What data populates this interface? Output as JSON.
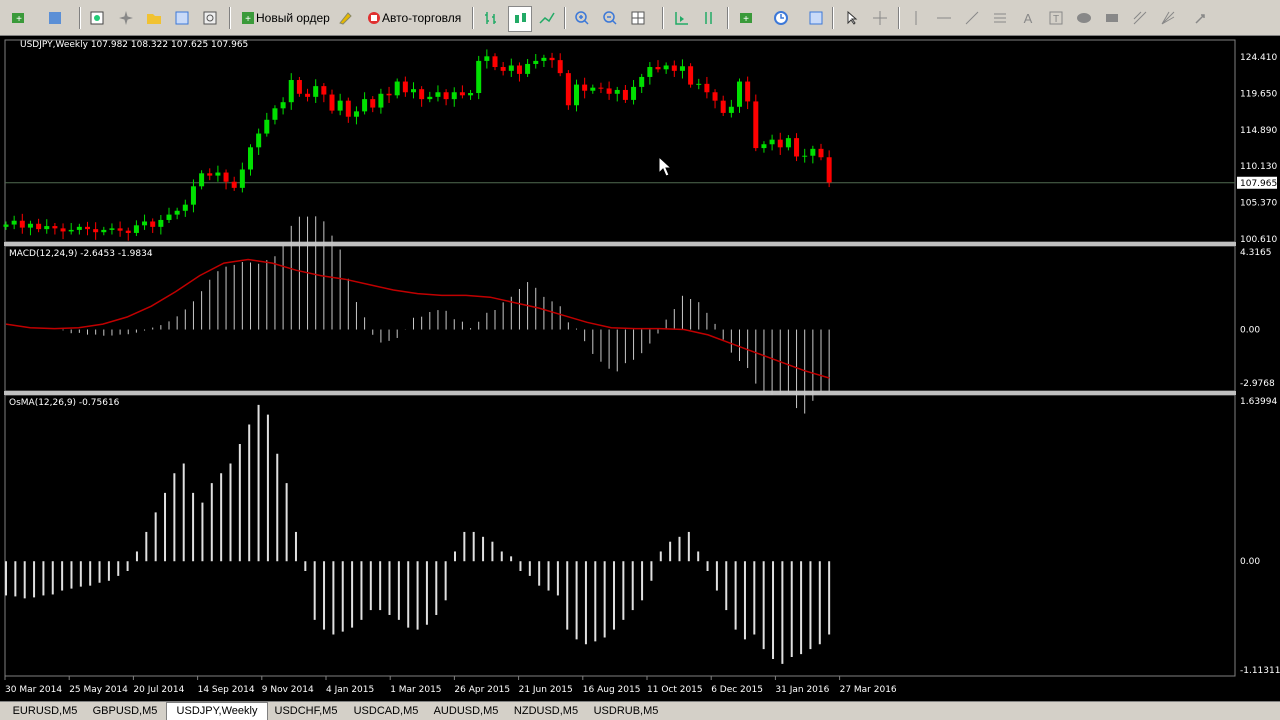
{
  "toolbar": {
    "new_order_label": "Новый ордер",
    "auto_trading_label": "Авто-торговля"
  },
  "chart": {
    "header": "USDJPY,Weekly  107.982 108.322 107.625 107.965",
    "price_axis": [
      "124.410",
      "119.650",
      "114.890",
      "110.130",
      "105.370",
      "100.610"
    ],
    "current_price": "107.965",
    "time_axis": [
      "30 Mar 2014",
      "25 May 2014",
      "20 Jul 2014",
      "14 Sep 2014",
      "9 Nov 2014",
      "4 Jan 2015",
      "1 Mar 2015",
      "26 Apr 2015",
      "21 Jun 2015",
      "16 Aug 2015",
      "11 Oct 2015",
      "6 Dec 2015",
      "31 Jan 2016",
      "27 Mar 2016"
    ]
  },
  "macd": {
    "label": "MACD(12,24,9) -2.6453 -1.9834",
    "scale": [
      "4.3165",
      "0.00",
      "-2.9768"
    ]
  },
  "osma": {
    "label": "OsMA(12,26,9) -0.75616",
    "scale": [
      "1.63994",
      "0.00",
      "-1.11311"
    ]
  },
  "colors": {
    "bull": "#00e000",
    "bear": "#ff0000",
    "grid": "#808080",
    "signal": "#c00000"
  },
  "tabs": [
    "EURUSD,M5",
    "GBPUSD,M5",
    "USDJPY,Weekly",
    "USDCHF,M5",
    "USDCAD,M5",
    "AUDUSD,M5",
    "NZDUSD,M5",
    "USDRUB,M5"
  ],
  "active_tab": "USDJPY,Weekly",
  "chart_data": {
    "type": "candlestick",
    "symbol": "USDJPY",
    "timeframe": "Weekly",
    "ohlc_last": {
      "open": 107.982,
      "high": 108.322,
      "low": 107.625,
      "close": 107.965
    },
    "closes": [
      102.5,
      103.0,
      102.1,
      102.6,
      101.9,
      102.3,
      102.0,
      101.6,
      101.8,
      102.2,
      101.9,
      101.5,
      101.8,
      102.0,
      101.7,
      101.4,
      102.4,
      102.9,
      102.2,
      103.1,
      103.8,
      104.3,
      105.1,
      107.5,
      109.2,
      108.9,
      109.3,
      108.1,
      107.3,
      109.7,
      112.6,
      114.4,
      116.2,
      117.7,
      118.5,
      121.4,
      119.6,
      119.2,
      120.6,
      119.5,
      117.4,
      118.7,
      116.6,
      117.3,
      118.9,
      117.8,
      119.6,
      119.4,
      121.2,
      119.8,
      120.2,
      118.9,
      119.2,
      119.8,
      118.9,
      119.8,
      119.4,
      119.7,
      123.9,
      124.5,
      123.1,
      122.6,
      123.3,
      122.2,
      123.5,
      123.9,
      124.3,
      124.0,
      122.3,
      118.1,
      120.8,
      120.0,
      120.4,
      120.3,
      119.6,
      120.1,
      118.8,
      120.5,
      121.8,
      123.1,
      122.8,
      123.3,
      122.6,
      123.2,
      120.8,
      120.9,
      119.8,
      118.7,
      117.1,
      117.9,
      121.2,
      118.6,
      112.5,
      113.0,
      113.6,
      112.6,
      113.8,
      111.4,
      111.5,
      112.4,
      111.3,
      108.0
    ],
    "macd_first": 0.8,
    "macd_zero_index": 26,
    "macd_signal_points": [
      0.3,
      0.1,
      0.05,
      0.1,
      0.3,
      0.7,
      1.3,
      2.1,
      3.0,
      3.7,
      3.9,
      3.7,
      3.3,
      3.0,
      2.8,
      2.5,
      2.2,
      2.0,
      1.9,
      1.9,
      1.8,
      1.5,
      1.2,
      0.8,
      0.4,
      0.1,
      0.05,
      0.05,
      0.0,
      -0.3,
      -0.8,
      -1.3,
      -1.8,
      -2.3,
      -2.7
    ],
    "osma_values": [
      -0.35,
      -0.36,
      -0.38,
      -0.37,
      -0.35,
      -0.34,
      -0.3,
      -0.28,
      -0.26,
      -0.25,
      -0.22,
      -0.2,
      -0.15,
      -0.1,
      0.1,
      0.3,
      0.5,
      0.7,
      0.9,
      1.0,
      0.7,
      0.6,
      0.8,
      0.9,
      1.0,
      1.2,
      1.4,
      1.6,
      1.5,
      1.1,
      0.8,
      0.3,
      -0.1,
      -0.6,
      -0.7,
      -0.75,
      -0.72,
      -0.68,
      -0.6,
      -0.5,
      -0.5,
      -0.55,
      -0.6,
      -0.68,
      -0.7,
      -0.65,
      -0.55,
      -0.4,
      0.1,
      0.3,
      0.3,
      0.25,
      0.2,
      0.1,
      0.05,
      -0.1,
      -0.15,
      -0.25,
      -0.3,
      -0.35,
      -0.7,
      -0.8,
      -0.85,
      -0.82,
      -0.78,
      -0.7,
      -0.6,
      -0.5,
      -0.4,
      -0.2,
      0.1,
      0.2,
      0.25,
      0.3,
      0.1,
      -0.1,
      -0.3,
      -0.5,
      -0.7,
      -0.8,
      -0.75,
      -0.9,
      -1.0,
      -1.05,
      -0.98,
      -0.95,
      -0.9,
      -0.85,
      -0.75
    ],
    "price_ylim": [
      100.61,
      124.41
    ],
    "macd_ylim": [
      -2.9768,
      4.3165
    ],
    "osma_ylim": [
      -1.11311,
      1.63994
    ]
  }
}
